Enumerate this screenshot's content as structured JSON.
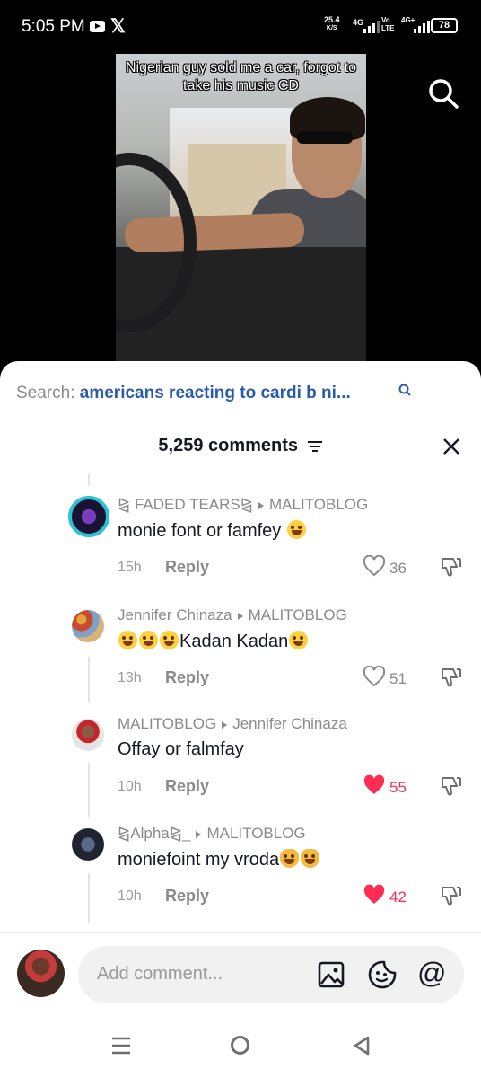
{
  "status_bar": {
    "time": "5:05 PM",
    "net_speed_value": "25.4",
    "net_speed_unit": "K/S",
    "network_4g": "4G",
    "volte_top": "Vo",
    "volte_bottom": "LTE",
    "network_4g2": "4G+",
    "battery": "78",
    "icons": [
      "youtube-icon",
      "x-icon",
      "signal-icon",
      "battery-icon"
    ]
  },
  "video": {
    "caption": "Nigerian guy sold me a car, forgot to take his music CD"
  },
  "search": {
    "prefix": "Search:",
    "query": "americans reacting to cardi b ni..."
  },
  "comments_header": {
    "count_label": "5,259 comments"
  },
  "comments": [
    {
      "user": "⧎ FADED TEARS⧎",
      "reply_to": "MALITOBLOG",
      "text": "monie font or famfey",
      "emojis": [
        "joy"
      ],
      "time": "15h",
      "reply_label": "Reply",
      "likes": "36",
      "liked": false
    },
    {
      "user": "Jennifer Chinaza",
      "reply_to": "MALITOBLOG",
      "text_prefix_emojis": [
        "joy",
        "joy",
        "joy"
      ],
      "text": "Kadan Kadan",
      "emojis": [
        "rofl"
      ],
      "time": "13h",
      "reply_label": "Reply",
      "likes": "51",
      "liked": false
    },
    {
      "user": "MALITOBLOG",
      "reply_to": "Jennifer Chinaza",
      "text": "Offay or falmfay",
      "emojis": [],
      "time": "10h",
      "reply_label": "Reply",
      "likes": "55",
      "liked": true
    },
    {
      "user": "⧎Alpha⧎_",
      "reply_to": "MALITOBLOG",
      "text": "moniefoint my vroda",
      "emojis": [
        "joy-cat",
        "joy-cat"
      ],
      "time": "10h",
      "reply_label": "Reply",
      "likes": "42",
      "liked": true
    }
  ],
  "input": {
    "placeholder": "Add comment...",
    "at_symbol": "@"
  },
  "colors": {
    "accent_red": "#fe2c55",
    "link_blue": "#2b5ca8",
    "text_dark": "#161823",
    "text_gray": "#8a8a8a"
  }
}
